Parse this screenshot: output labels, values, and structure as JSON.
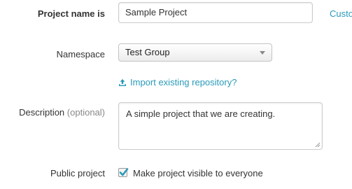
{
  "form": {
    "project_name": {
      "label": "Project name is",
      "value": "Sample Project",
      "side_link": "Custo"
    },
    "namespace": {
      "label": "Namespace",
      "selected": "Test Group"
    },
    "import_link": "Import existing repository?",
    "description": {
      "label": "Description",
      "optional_hint": "(optional)",
      "value": "A simple project that we are creating."
    },
    "public_project": {
      "label": "Public project",
      "checkbox_label": "Make project visible to everyone",
      "checked": true
    }
  },
  "colors": {
    "link": "#2a9ab8",
    "check": "#2a9ab8"
  },
  "icons": {
    "import": "upload-icon",
    "select": "caret-down-icon",
    "checkbox": "checkmark-icon"
  }
}
